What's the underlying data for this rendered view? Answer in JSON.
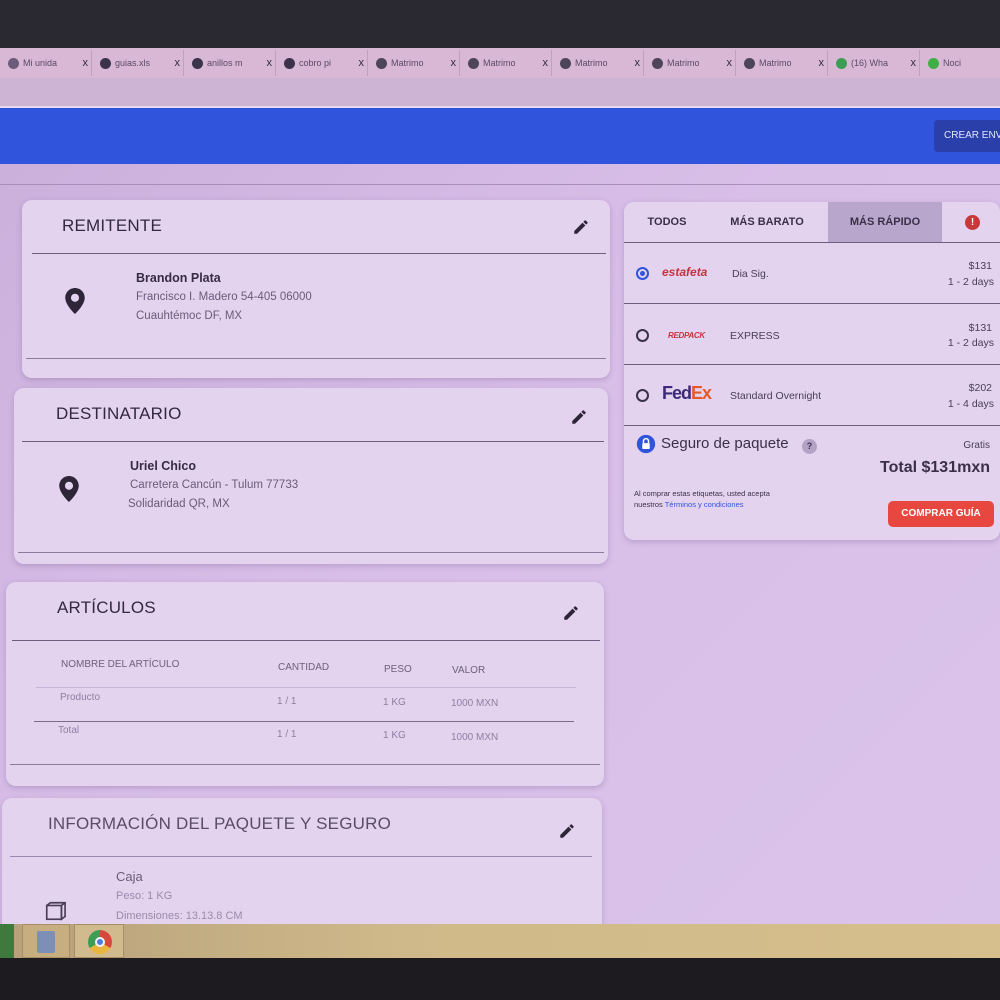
{
  "browser": {
    "tabs": [
      {
        "label": "Mi unida",
        "icon": "drive-icon"
      },
      {
        "label": "guias.xls",
        "icon": "doc-icon"
      },
      {
        "label": "anillos m",
        "icon": "doc-icon"
      },
      {
        "label": "cobro pi",
        "icon": "doc-icon"
      },
      {
        "label": "Matrimo",
        "icon": "globe-icon"
      },
      {
        "label": "Matrimo",
        "icon": "globe-icon"
      },
      {
        "label": "Matrimo",
        "icon": "globe-icon"
      },
      {
        "label": "Matrimo",
        "icon": "globe-icon"
      },
      {
        "label": "Matrimo",
        "icon": "globe-icon"
      },
      {
        "label": "(16) Wha",
        "icon": "whatsapp-icon"
      },
      {
        "label": "Noci",
        "icon": "green-dot-icon"
      }
    ],
    "tab_close": "x"
  },
  "header": {
    "create_label": "CREAR ENV",
    "color": "#3154dc"
  },
  "sender": {
    "title": "REMITENTE",
    "name": "Brandon Plata",
    "line1": "Francisco I. Madero 54-405 06000",
    "line2": "Cuauhtémoc DF, MX"
  },
  "recipient": {
    "title": "DESTINATARIO",
    "name": "Uriel Chico",
    "line1": "Carretera Cancún - Tulum 77733",
    "line2": "Solidaridad QR, MX"
  },
  "items": {
    "title": "ARTÍCULOS",
    "columns": [
      "NOMBRE DEL ARTÍCULO",
      "CANTIDAD",
      "PESO",
      "VALOR"
    ],
    "rows": [
      [
        "Producto",
        "1 / 1",
        "1 KG",
        "1000 MXN"
      ],
      [
        "Total",
        "1 / 1",
        "1 KG",
        "1000 MXN"
      ]
    ]
  },
  "package": {
    "title": "INFORMACIÓN DEL PAQUETE Y SEGURO",
    "type": "Caja",
    "weight": "Peso: 1 KG",
    "dimensions": "Dimensiones: 13.13.8 CM"
  },
  "rates": {
    "tabs": [
      "TODOS",
      "MÁS BARATO",
      "MÁS RÁPIDO"
    ],
    "active_tab": "MÁS RÁPIDO",
    "options": [
      {
        "carrier": "estafeta",
        "service": "Dia Sig.",
        "price": "$131",
        "days": "1 - 2 days",
        "selected": true
      },
      {
        "carrier": "REDPACK",
        "service": "EXPRESS",
        "price": "$131",
        "days": "1 - 2 days",
        "selected": false
      },
      {
        "carrier_fed": "Fed",
        "carrier_ex": "Ex",
        "service": "Standard Overnight",
        "price": "$202",
        "days": "1 - 4 days",
        "selected": false
      }
    ],
    "insurance_label": "Seguro de paquete",
    "insurance_help": "?",
    "insurance_price": "Gratis",
    "total": "Total $131mxn",
    "terms_prefix": "Al comprar estas etiquetas, usted acepta nuestros ",
    "terms_link": "Términos y condiciones",
    "buy_label": "COMPRAR GUÍA",
    "accent_red": "#e8473f",
    "link_blue": "#3154dc"
  }
}
